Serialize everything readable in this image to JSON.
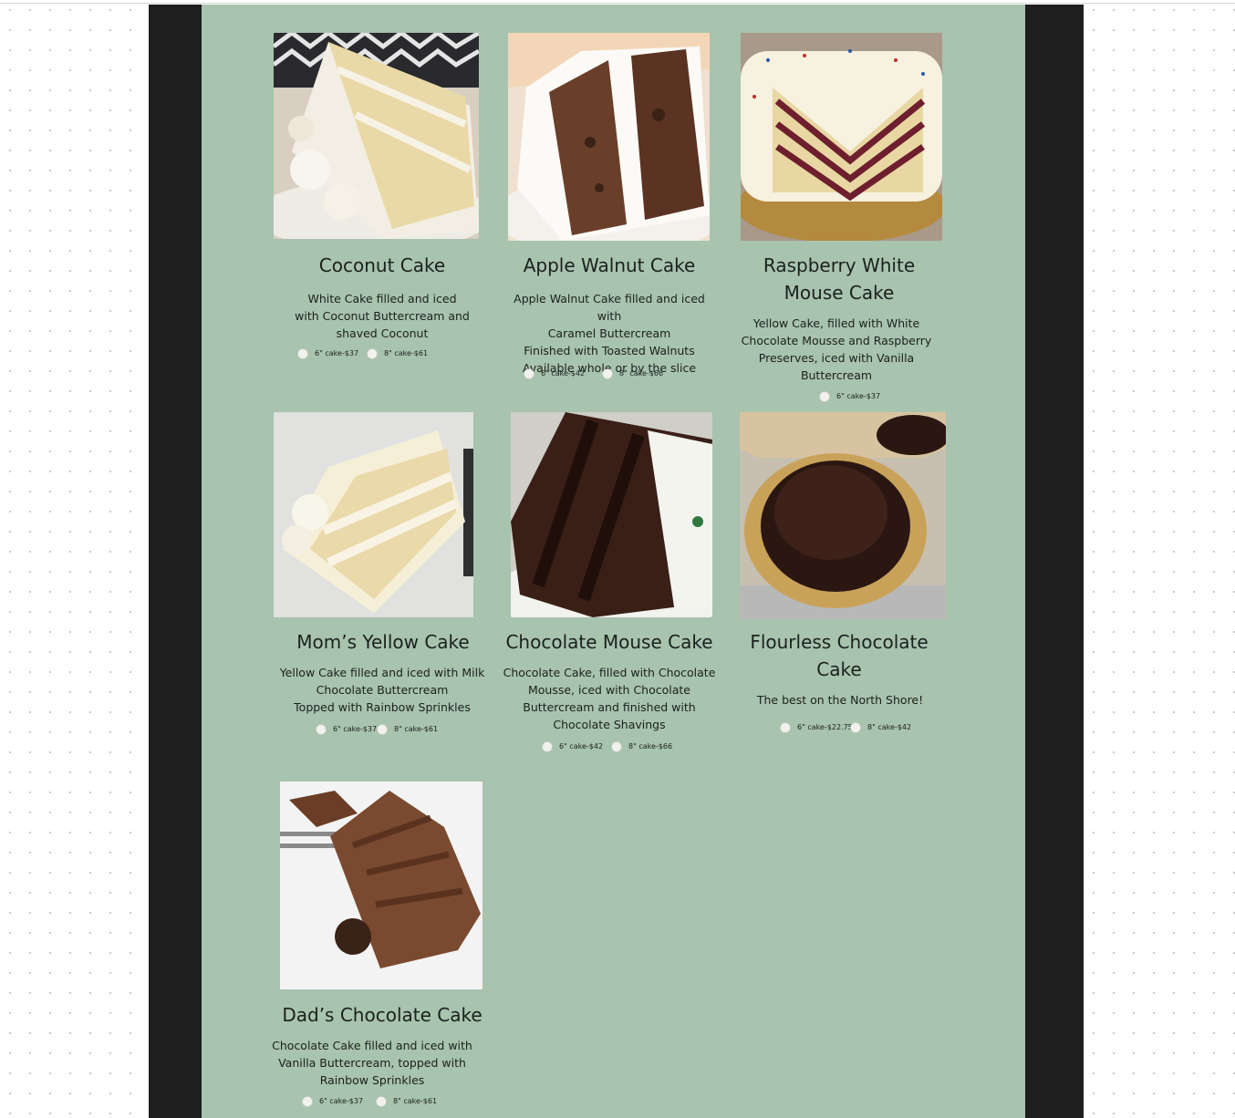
{
  "cakes": [
    {
      "name": "Coconut Cake",
      "description": [
        "White Cake filled and iced",
        "with Coconut Buttercream and",
        "shaved Coconut"
      ],
      "options": [
        "6\" cake-$37",
        "8\" cake-$61"
      ]
    },
    {
      "name": "Apple Walnut Cake",
      "description": [
        "Apple Walnut Cake filled and iced with",
        "Caramel Buttercream",
        "Finished with Toasted Walnuts",
        "Available whole or by the slice"
      ],
      "options": [
        "6\" cake-$42",
        "8\" cake-$66"
      ]
    },
    {
      "name": [
        "Raspberry White",
        "Mouse Cake"
      ],
      "description": [
        "Yellow Cake, filled with White",
        "Chocolate Mousse and Raspberry",
        "Preserves, iced with Vanilla",
        "Buttercream"
      ],
      "options": [
        "6\" cake-$37"
      ]
    },
    {
      "name": "Mom’s Yellow Cake",
      "description": [
        "Yellow Cake filled and iced with Milk",
        "Chocolate Buttercream",
        "Topped with Rainbow Sprinkles"
      ],
      "options": [
        "6\" cake-$37",
        "8\" cake-$61"
      ]
    },
    {
      "name": "Chocolate Mouse Cake",
      "description": [
        "Chocolate Cake, filled with Chocolate",
        "Mousse, iced with Chocolate",
        "Buttercream and finished with",
        "Chocolate Shavings"
      ],
      "options": [
        "6\" cake-$42",
        "8\" cake-$66"
      ]
    },
    {
      "name": [
        "Flourless Chocolate",
        "Cake"
      ],
      "description": [
        "The best on the North Shore!"
      ],
      "options": [
        "6\" cake-$22.75",
        "8\" cake-$42"
      ]
    },
    {
      "name": "Dad’s Chocolate Cake",
      "description": [
        "Chocolate Cake filled and iced with",
        "Vanilla Buttercream, topped with",
        "Rainbow Sprinkles"
      ],
      "options": [
        "6\" cake-$37",
        "8\" cake-$61"
      ]
    }
  ]
}
